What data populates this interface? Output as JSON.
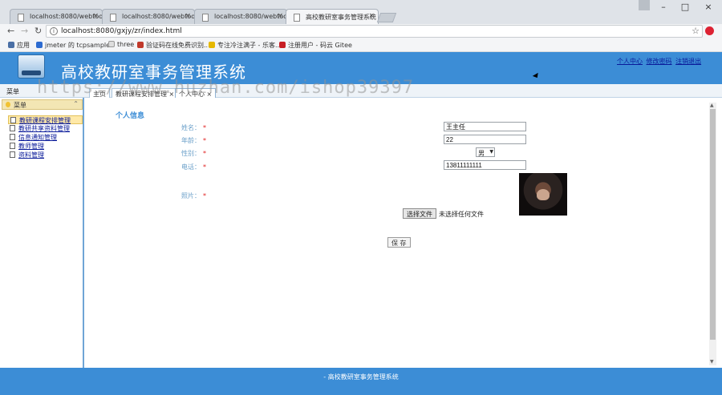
{
  "browser": {
    "tabs": [
      {
        "title": "localhost:8080/webtoo"
      },
      {
        "title": "localhost:8080/webtoo"
      },
      {
        "title": "localhost:8080/webtoo"
      },
      {
        "title": "高校教研室事务管理系统"
      }
    ],
    "url": "localhost:8080/gxjy/zr/index.html",
    "bookmarks": [
      {
        "label": "应用",
        "icon": "apps-grid-icon",
        "color": "#4a6fa5"
      },
      {
        "label": "jmeter 的 tcpsample",
        "icon": "shield-icon",
        "color": "#2d6bd0"
      },
      {
        "label": "three",
        "icon": "page-icon",
        "color": "#999999"
      },
      {
        "label": "验证码在线免费识别...",
        "icon": "badge-icon",
        "color": "#c0392b"
      },
      {
        "label": "专注冷注满子 - 乐客...",
        "icon": "hand-icon",
        "color": "#e6b800"
      },
      {
        "label": "注册用户 - 码云 Gitee",
        "icon": "gitee-icon",
        "color": "#c71d23"
      }
    ]
  },
  "app": {
    "title": "高校教研室事务管理系统",
    "header_links": [
      "个人中心",
      "修改密码",
      "注销退出"
    ],
    "watermark": "https://www.huzhan.com/ishop39397",
    "menubar_label": "菜单",
    "content_tabs": [
      {
        "label": "主页"
      },
      {
        "label": "教研课程安排管理 ×"
      },
      {
        "label": "个人中心 ×"
      }
    ],
    "sidebar": {
      "title": "菜单",
      "items": [
        {
          "label": "教研课程安排管理",
          "selected": true
        },
        {
          "label": "教研共享资料管理",
          "selected": false
        },
        {
          "label": "信息通知管理",
          "selected": false
        },
        {
          "label": "教师管理",
          "selected": false
        },
        {
          "label": "资料管理",
          "selected": false
        }
      ]
    },
    "form": {
      "section_title": "个人信息",
      "name_label": "姓名：",
      "name_value": "王主任",
      "age_label": "年龄：",
      "age_value": "22",
      "gender_label": "性别：",
      "gender_value": "男",
      "phone_label": "电话：",
      "phone_value": "13811111111",
      "photo_label": "照片：",
      "file_button": "选择文件",
      "file_status": "未选择任何文件",
      "save_button": "保 存",
      "required_mark": "*"
    },
    "footer": "- 高校教研室事务管理系统"
  },
  "colors": {
    "brand": "#3c8dd6",
    "label": "#6a9fc9",
    "required": "#e02020",
    "link": "#0a1a9a"
  }
}
